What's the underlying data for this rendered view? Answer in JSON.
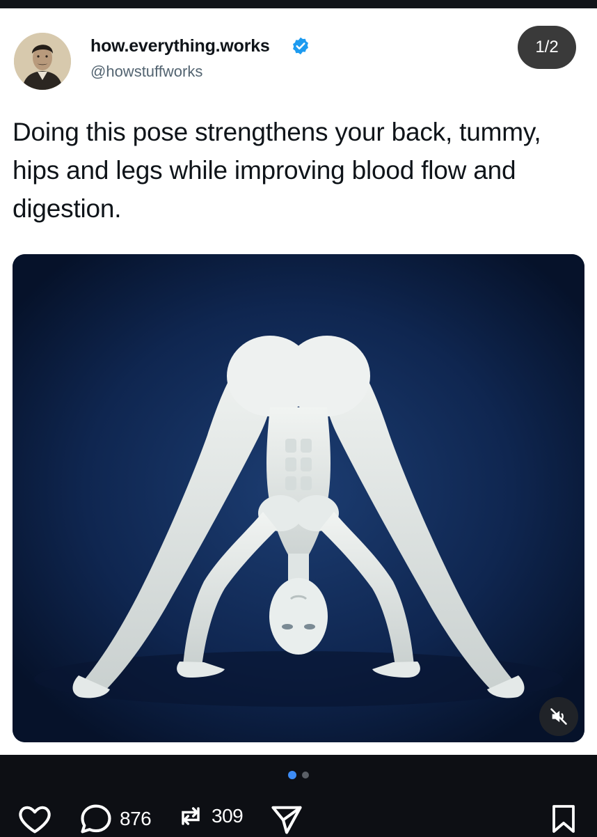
{
  "post": {
    "author_name": "how.everything.works",
    "author_handle": "@howstuffworks",
    "verified": true,
    "page_indicator": "1/2",
    "text": "Doing this pose strengthens your back, tummy, hips and legs while improving blood flow and digestion."
  },
  "media": {
    "type": "illustration",
    "muted": true,
    "carousel_total": 2,
    "carousel_index": 1
  },
  "actions": {
    "replies": "876",
    "reposts": "309"
  },
  "colors": {
    "verified_blue": "#1d9bf0",
    "carousel_active": "#3d8cf5",
    "media_background": "#0b1a36"
  },
  "icons": [
    "heart-icon",
    "reply-icon",
    "repost-icon",
    "share-icon",
    "bookmark-icon",
    "mute-icon",
    "verified-icon"
  ]
}
